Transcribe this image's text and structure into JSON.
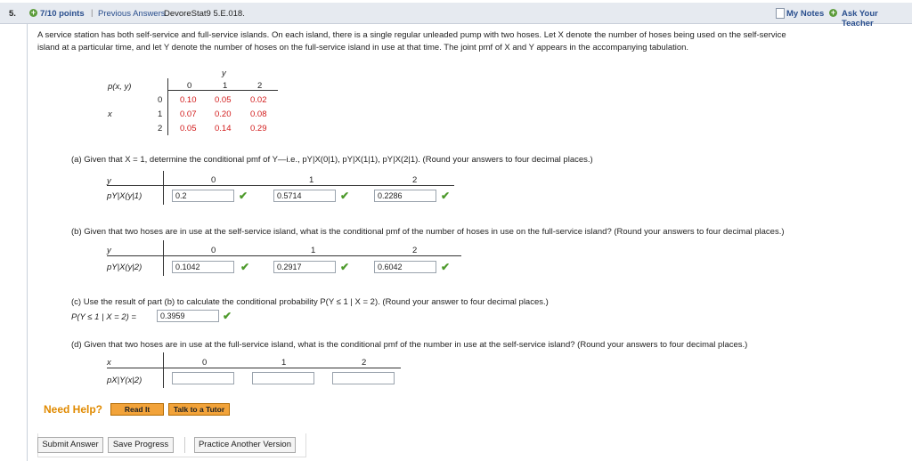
{
  "header": {
    "question_number": "5.",
    "points": "7/10 points",
    "sep1": "|",
    "previous_answers": "Previous Answers",
    "source": "DevoreStat9 5.E.018.",
    "my_notes": "My Notes",
    "ask_teacher": "Ask Your Teacher"
  },
  "problem": {
    "text_line1": "A service station has both self-service and full-service islands. On each island, there is a single regular unleaded pump with two hoses. Let X denote the number of hoses being used on the self-service",
    "text_line2": "island at a particular time, and let Y denote the number of hoses on the full-service island in use at that time. The joint pmf of X and Y appears in the accompanying tabulation."
  },
  "joint_table": {
    "y_label": "y",
    "corner_label": "p(x, y)",
    "x_label": "x",
    "col_headers": [
      "0",
      "1",
      "2"
    ],
    "row_headers": [
      "0",
      "1",
      "2"
    ],
    "rows": [
      [
        "0.10",
        "0.05",
        "0.02"
      ],
      [
        "0.07",
        "0.20",
        "0.08"
      ],
      [
        "0.05",
        "0.14",
        "0.29"
      ]
    ]
  },
  "part_a": {
    "question": "(a) Given that X = 1, determine the conditional pmf of Y—i.e., pY|X(0|1), pY|X(1|1), pY|X(2|1). (Round your answers to four decimal places.)",
    "row1_label": "y",
    "row2_label": "pY|X(y|1)",
    "cols": [
      "0",
      "1",
      "2"
    ],
    "answers": [
      "0.2",
      "0.5714",
      "0.2286"
    ]
  },
  "part_b": {
    "question": "(b) Given that two hoses are in use at the self-service island, what is the conditional pmf of the number of hoses in use on the full-service island? (Round your answers to four decimal places.)",
    "row1_label": "y",
    "row2_label": "pY|X(y|2)",
    "cols": [
      "0",
      "1",
      "2"
    ],
    "answers": [
      "0.1042",
      "0.2917",
      "0.6042"
    ]
  },
  "part_c": {
    "question": "(c) Use the result of part (b) to calculate the conditional probability P(Y ≤ 1 | X = 2). (Round your answer to four decimal places.)",
    "label": "P(Y ≤ 1 | X = 2) =",
    "answer": "0.3959"
  },
  "part_d": {
    "question": "(d) Given that two hoses are in use at the full-service island, what is the conditional pmf of the number in use at the self-service island? (Round your answers to four decimal places.)",
    "row1_label": "x",
    "row2_label": "pX|Y(x|2)",
    "cols": [
      "0",
      "1",
      "2"
    ],
    "answers": [
      "",
      "",
      ""
    ]
  },
  "help": {
    "label": "Need Help?",
    "read_it": "Read It",
    "talk_tutor": "Talk to a Tutor"
  },
  "footer": {
    "submit": "Submit Answer",
    "save": "Save Progress",
    "practice": "Practice Another Version"
  },
  "colors": {
    "link": "#2a4f8e",
    "red_values": "#d21b1b",
    "check": "#4e9a2c",
    "help": "#e08a00"
  }
}
